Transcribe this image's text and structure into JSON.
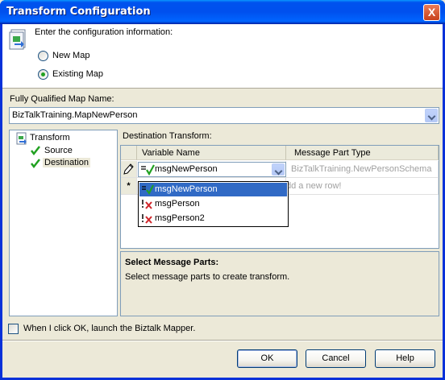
{
  "window": {
    "title": "Transform Configuration",
    "close_glyph": "X"
  },
  "header": {
    "prompt": "Enter the configuration information:",
    "icon": "transform-config-icon",
    "options": [
      {
        "label": "New Map",
        "selected": false
      },
      {
        "label": "Existing Map",
        "selected": true
      }
    ]
  },
  "map_name": {
    "label": "Fully Qualified Map Name:",
    "value": "BizTalkTraining.MapNewPerson"
  },
  "tree": {
    "root": "Transform",
    "items": [
      {
        "label": "Source",
        "checked": true
      },
      {
        "label": "Destination",
        "checked": true,
        "selected": true
      }
    ]
  },
  "destination": {
    "label": "Destination Transform:",
    "columns": [
      "Variable Name",
      "Message Part Type"
    ],
    "row": {
      "variable": "msgNewPerson",
      "type": "BizTalkTraining.NewPersonSchema"
    },
    "new_row_text": "dd a new row!",
    "new_row_glyph": "*",
    "dropdown_items": [
      {
        "label": "msgNewPerson",
        "selected": true,
        "icon": "message-valid-icon"
      },
      {
        "label": "msgPerson",
        "selected": false,
        "icon": "message-invalid-icon"
      },
      {
        "label": "msgPerson2",
        "selected": false,
        "icon": "message-invalid-icon"
      }
    ]
  },
  "info": {
    "title": "Select Message Parts:",
    "text": "Select message parts to create transform."
  },
  "launch_mapper": {
    "label": "When I click OK, launch the Biztalk Mapper.",
    "checked": false
  },
  "buttons": {
    "ok": "OK",
    "cancel": "Cancel",
    "help": "Help"
  },
  "colors": {
    "titlebar": "#0054e3",
    "selection": "#316ac5",
    "check": "#21a121",
    "error": "#d0262b"
  }
}
